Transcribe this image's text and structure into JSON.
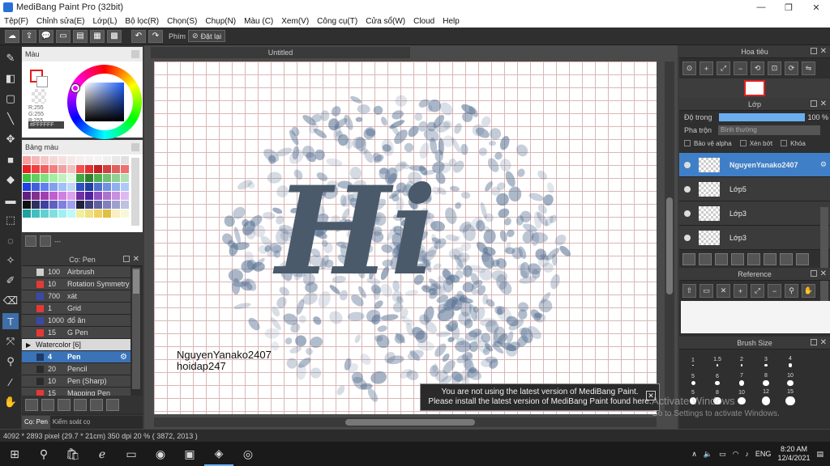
{
  "window": {
    "title": "MediBang Paint Pro (32bit)",
    "min": "—",
    "max": "❐",
    "close": "✕"
  },
  "menu": [
    "Tệp(F)",
    "Chỉnh sửa(E)",
    "Lớp(L)",
    "Bộ lọc(R)",
    "Chọn(S)",
    "Chụp(N)",
    "Màu (C)",
    "Xem(V)",
    "Công cụ(T)",
    "Cửa sổ(W)",
    "Cloud",
    "Help"
  ],
  "toolbar": {
    "key_label": "Phím",
    "reset_label": "Đặt lại"
  },
  "color_panel": {
    "title": "Màu",
    "r": "R:255",
    "g": "G:255",
    "b": "B:255",
    "hex": "#FFFFFF"
  },
  "palette_panel": {
    "title": "Bảng màu",
    "foot_text": "---",
    "colors": [
      "#f4a0a0",
      "#f4b8b8",
      "#f4c8c8",
      "#f4d8d8",
      "#f4e0e0",
      "#f4e8e8",
      "#f4eeee",
      "#f4f0f0",
      "#f4f4f4",
      "#f0f0f0",
      "#e8e8e8",
      "#e0e0e0",
      "#e82020",
      "#f04040",
      "#f06060",
      "#f08080",
      "#f0a0a0",
      "#f0c0c0",
      "#f05050",
      "#e03030",
      "#c02020",
      "#d04040",
      "#e06060",
      "#f07070",
      "#40c040",
      "#60d060",
      "#80e080",
      "#a0f0a0",
      "#c0f0c0",
      "#e0f8e0",
      "#40a840",
      "#308030",
      "#50b050",
      "#70c070",
      "#90d090",
      "#b0e0b0",
      "#2040e0",
      "#4060e0",
      "#6080f0",
      "#80a0f0",
      "#a0c0f8",
      "#c0d8f8",
      "#3050c0",
      "#2040a0",
      "#5070d0",
      "#7090e0",
      "#90b0f0",
      "#b0c8f8",
      "#602080",
      "#803090",
      "#a040b0",
      "#c060d0",
      "#d080e0",
      "#e0a0f0",
      "#7030a0",
      "#5020a0",
      "#9050c0",
      "#b070d0",
      "#c890e0",
      "#e0b8f0",
      "#101010",
      "#303060",
      "#4040a0",
      "#6060c0",
      "#8080e0",
      "#a0a0f0",
      "#202040",
      "#404080",
      "#6060a0",
      "#8080c0",
      "#a0a0d0",
      "#c0c0e0",
      "#20a0a0",
      "#40c0c0",
      "#60d0d0",
      "#80e0e0",
      "#a0f0f0",
      "#c0f8f8",
      "#f0f0a0",
      "#f0e080",
      "#f0d060",
      "#e0c040",
      "#f8f0c0",
      "#f8f8d8"
    ]
  },
  "brush_panel": {
    "title": "Cọ: Pen",
    "items": [
      {
        "size": "100",
        "name": "Airbrush",
        "color": "#cfcfcf",
        "kind": "plain"
      },
      {
        "size": "10",
        "name": "Rotation Symmetry",
        "color": "#e53935",
        "kind": "plain"
      },
      {
        "size": "700",
        "name": "xát",
        "color": "#3949ab",
        "kind": "plain"
      },
      {
        "size": "1",
        "name": "Grid",
        "color": "#e53935",
        "kind": "plain"
      },
      {
        "size": "1000",
        "name": "đổ ăn",
        "color": "#3949ab",
        "kind": "plain"
      },
      {
        "size": "15",
        "name": "G Pen",
        "color": "#e53935",
        "kind": "plain"
      },
      {
        "size": "",
        "name": "Watercolor [6]",
        "color": "",
        "kind": "group"
      },
      {
        "size": "4",
        "name": "Pen",
        "color": "#1f3a63",
        "kind": "selected"
      },
      {
        "size": "20",
        "name": "Pencil",
        "color": "#2a2a2a",
        "kind": "plain"
      },
      {
        "size": "10",
        "name": "Pen (Sharp)",
        "color": "#2a2a2a",
        "kind": "plain"
      },
      {
        "size": "15",
        "name": "Mapping Pen",
        "color": "#e53935",
        "kind": "plain"
      }
    ],
    "tabs": [
      "Cọ: Pen",
      "Kiểm soát cọ"
    ]
  },
  "canvas": {
    "tab_title": "Untitled",
    "signature_line1": "NguyenYanako2407",
    "signature_line2": "hoidap247",
    "art_word": "Hi",
    "notice_line1": "You are not using the latest version of MediBang Paint.",
    "notice_line2": "Please install the latest version of MediBang Paint found here."
  },
  "navigator": {
    "title": "Hoa tiêu"
  },
  "layer_panel": {
    "title": "Lớp",
    "opacity_label": "Độ trong",
    "opacity_value": "100 %",
    "opacity_fraction": 1.0,
    "blend_label": "Pha trộn",
    "blend_value": "Bình thường",
    "protect_alpha": "Bảo vệ alpha",
    "clipping": "Xén bớt",
    "lock": "Khóa",
    "layers": [
      {
        "name": "NguyenYanako2407",
        "active": true
      },
      {
        "name": "Lớp5",
        "active": false
      },
      {
        "name": "Lớp3",
        "active": false
      },
      {
        "name": "Lớp3",
        "active": false
      }
    ]
  },
  "reference_panel": {
    "title": "Reference"
  },
  "brush_size_panel": {
    "title": "Brush Size",
    "sizes": [
      "1",
      "1.5",
      "2",
      "3",
      "4",
      "5",
      "6",
      "7",
      "8",
      "10",
      "5",
      "8",
      "10",
      "12",
      "15"
    ]
  },
  "status": {
    "dimensions": "4092 * 2893 pixel",
    "paper": "(29.7 * 21cm)",
    "dpi": "350 dpi",
    "zoom": "20 %",
    "coords": "( 3872, 2013 )"
  },
  "activation": {
    "title": "Activate Windows",
    "subtitle": "Go to Settings to activate Windows."
  },
  "taskbar": {
    "lang": "ENG",
    "time": "8:20 AM",
    "date": "12/4/2021"
  }
}
